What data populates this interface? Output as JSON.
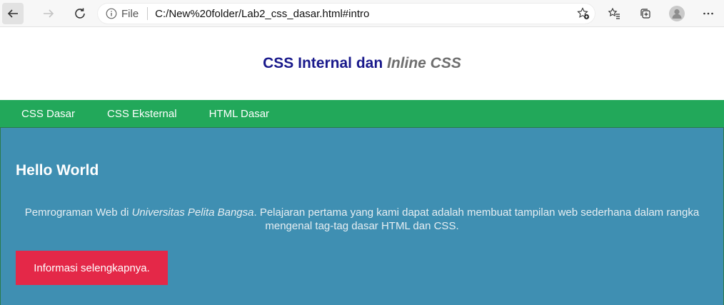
{
  "browser": {
    "info_label": "File",
    "url": "C:/New%20folder/Lab2_css_dasar.html#intro"
  },
  "header": {
    "title_main": "CSS Internal dan ",
    "title_italic": "Inline CSS"
  },
  "nav": {
    "items": [
      {
        "label": "CSS Dasar"
      },
      {
        "label": "CSS Eksternal"
      },
      {
        "label": "HTML Dasar"
      }
    ]
  },
  "hero": {
    "title": "Hello World",
    "text_before": "Pemrograman Web di ",
    "text_italic": "Universitas Pelita Bangsa",
    "text_after": ". Pelajaran pertama yang kami dapat adalah membuat tampilan web sederhana dalam rangka mengenal tag-tag dasar HTML dan CSS.",
    "button_label": "Informasi selengkapnya."
  },
  "colors": {
    "navbar": "#22a85a",
    "hero": "#3f8fb2",
    "button": "#e42848",
    "title": "#1a1a8c"
  }
}
